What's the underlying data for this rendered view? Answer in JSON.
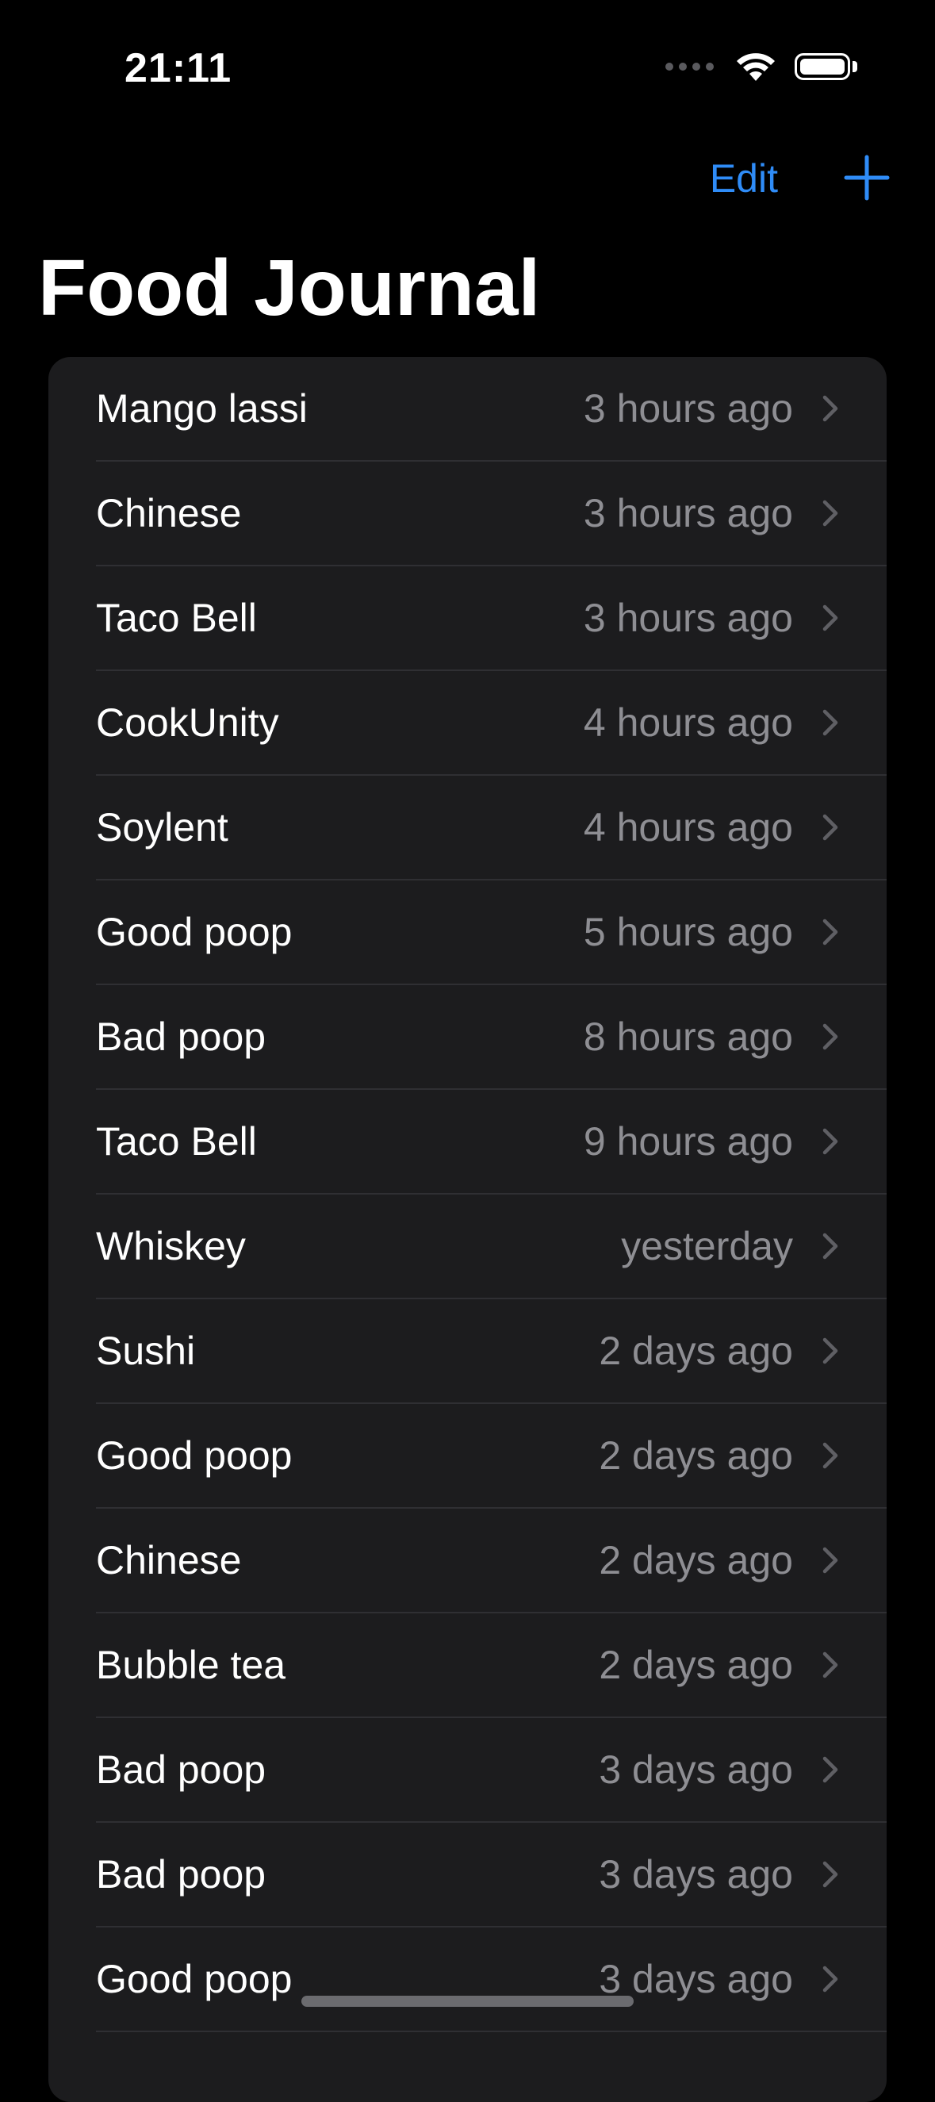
{
  "status_bar": {
    "time": "21:11",
    "signal_icon": "signal-dots-icon",
    "wifi_icon": "wifi-icon",
    "battery_icon": "battery-icon"
  },
  "nav": {
    "edit_label": "Edit",
    "add_icon": "plus-icon"
  },
  "page_title": "Food Journal",
  "colors": {
    "accent": "#2f8cf7",
    "background": "#000000",
    "card": "#1c1c1e",
    "secondary_text": "#8e8e93"
  },
  "entries": [
    {
      "name": "Mango lassi",
      "time": "3 hours ago"
    },
    {
      "name": "Chinese",
      "time": "3 hours ago"
    },
    {
      "name": "Taco Bell",
      "time": "3 hours ago"
    },
    {
      "name": "CookUnity",
      "time": "4 hours ago"
    },
    {
      "name": "Soylent",
      "time": "4 hours ago"
    },
    {
      "name": "Good poop",
      "time": "5 hours ago"
    },
    {
      "name": "Bad poop",
      "time": "8 hours ago"
    },
    {
      "name": "Taco Bell",
      "time": "9 hours ago"
    },
    {
      "name": "Whiskey",
      "time": "yesterday"
    },
    {
      "name": "Sushi",
      "time": "2 days ago"
    },
    {
      "name": "Good poop",
      "time": "2 days ago"
    },
    {
      "name": "Chinese",
      "time": "2 days ago"
    },
    {
      "name": "Bubble tea",
      "time": "2 days ago"
    },
    {
      "name": "Bad poop",
      "time": "3 days ago"
    },
    {
      "name": "Bad poop",
      "time": "3 days ago"
    },
    {
      "name": "Good poop",
      "time": "3 days ago"
    }
  ]
}
